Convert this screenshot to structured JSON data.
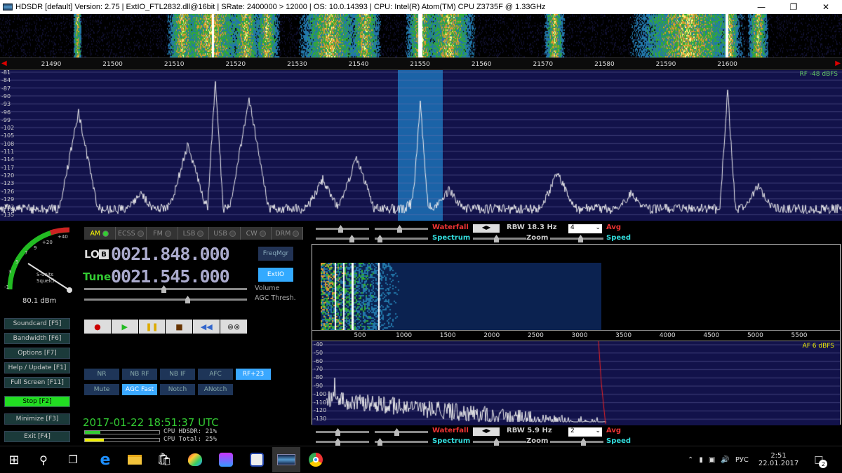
{
  "title": "HDSDR  [default]  Version: 2.75   |  ExtIO_FTL2832.dll@16bit  |  SRate: 2400000 > 12000  |  OS: 10.0.14393   |  CPU: Intel(R) Atom(TM) CPU  Z3735F @ 1.33GHz",
  "freq_axis": [
    "21490",
    "21500",
    "21510",
    "21520",
    "21530",
    "21540",
    "21550",
    "21560",
    "21570",
    "21580",
    "21590",
    "21600"
  ],
  "db_labels": [
    "-81",
    "-84",
    "-87",
    "-90",
    "-93",
    "-96",
    "-99",
    "-102",
    "-105",
    "-108",
    "-111",
    "-114",
    "-117",
    "-120",
    "-123",
    "-126",
    "-129",
    "-132",
    "-135"
  ],
  "rf_label": "RF -48 dBFS",
  "smeter": {
    "scale": [
      "-1",
      "3",
      "5",
      "7",
      "9",
      "+20",
      "+40"
    ],
    "caption1": "S-units",
    "caption2": "Squelch",
    "dbm": "80.1 dBm"
  },
  "modes": [
    "AM",
    "ECSS",
    "FM",
    "LSB",
    "USB",
    "CW",
    "DRM"
  ],
  "lo": {
    "label": "LO",
    "badge": "B",
    "value": "0021.848.000"
  },
  "tune": {
    "label": "Tune",
    "value": "0021.545.000"
  },
  "freqmgr": "FreqMgr",
  "extio": "ExtIO",
  "volume": "Volume",
  "agc": "AGC Thresh.",
  "side": [
    "Soundcard  [F5]",
    "Bandwidth  [F6]",
    "Options  [F7]",
    "Help / Update  [F1]",
    "Full Screen  [F11]",
    "Stop  [F2]",
    "Minimize  [F3]",
    "Exit  [F4]"
  ],
  "transport": [
    "●",
    "▶",
    "❚❚",
    "■",
    "◀◀",
    "⊗⊗"
  ],
  "dsp_row1": [
    "NR",
    "NB RF",
    "NB IF",
    "AFC",
    "RF+23"
  ],
  "dsp_row2": [
    "Mute",
    "AGC Fast",
    "Notch",
    "ANotch"
  ],
  "clock": "2017-01-22  18:51:37 UTC",
  "cpu": [
    {
      "label": "CPU HDSDR: 21%",
      "value": 0.21
    },
    {
      "label": "CPU Total: 25%",
      "value": 0.25
    }
  ],
  "top_ctrl": {
    "waterfall": "Waterfall",
    "spectrum": "Spectrum",
    "rbw": "RBW 18.3 Hz",
    "zoom": "Zoom",
    "avg_val": "4",
    "avg": "Avg",
    "speed": "Speed"
  },
  "bot_ctrl": {
    "waterfall": "Waterfall",
    "spectrum": "Spectrum",
    "rbw": "RBW  5.9 Hz",
    "zoom": "Zoom",
    "avg_val": "2",
    "avg": "Avg",
    "speed": "Speed"
  },
  "af_axis": [
    "500",
    "1000",
    "1500",
    "2000",
    "2500",
    "3000",
    "3500",
    "4000",
    "4500",
    "5000",
    "5500"
  ],
  "af_db": [
    "-40",
    "-50",
    "-60",
    "-70",
    "-80",
    "-90",
    "-100",
    "-110",
    "-120",
    "-130"
  ],
  "af_label": "AF   6 dBFS",
  "tray": {
    "lang": "РУС",
    "time": "2:51",
    "date": "22.01.2017",
    "notif": "2"
  }
}
